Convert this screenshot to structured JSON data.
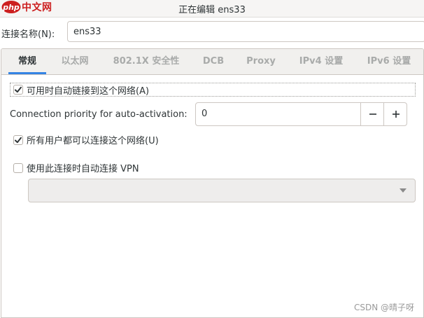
{
  "logo": {
    "text": "中文网",
    "mark": "php"
  },
  "window": {
    "title": "正在编辑 ens33"
  },
  "connection_name": {
    "label": "连接名称(N):",
    "value": "ens33"
  },
  "tabs": [
    {
      "label": "常规",
      "active": true
    },
    {
      "label": "以太网",
      "active": false
    },
    {
      "label": "802.1X 安全性",
      "active": false
    },
    {
      "label": "DCB",
      "active": false
    },
    {
      "label": "Proxy",
      "active": false
    },
    {
      "label": "IPv4 设置",
      "active": false
    },
    {
      "label": "IPv6 设置",
      "active": false
    }
  ],
  "general": {
    "autoconnect": {
      "label": "可用时自动链接到这个网络(A)",
      "checked": true
    },
    "priority": {
      "label": "Connection priority for auto-activation:",
      "value": "0"
    },
    "all_users": {
      "label": "所有用户都可以连接这个网络(U)",
      "checked": true
    },
    "vpn": {
      "label": "使用此连接时自动连接 VPN",
      "checked": false
    },
    "vpn_select": {
      "value": ""
    }
  },
  "watermark": "CSDN @晴子呀",
  "colors": {
    "accent": "#3584e4",
    "logo": "#cc1f1f"
  }
}
